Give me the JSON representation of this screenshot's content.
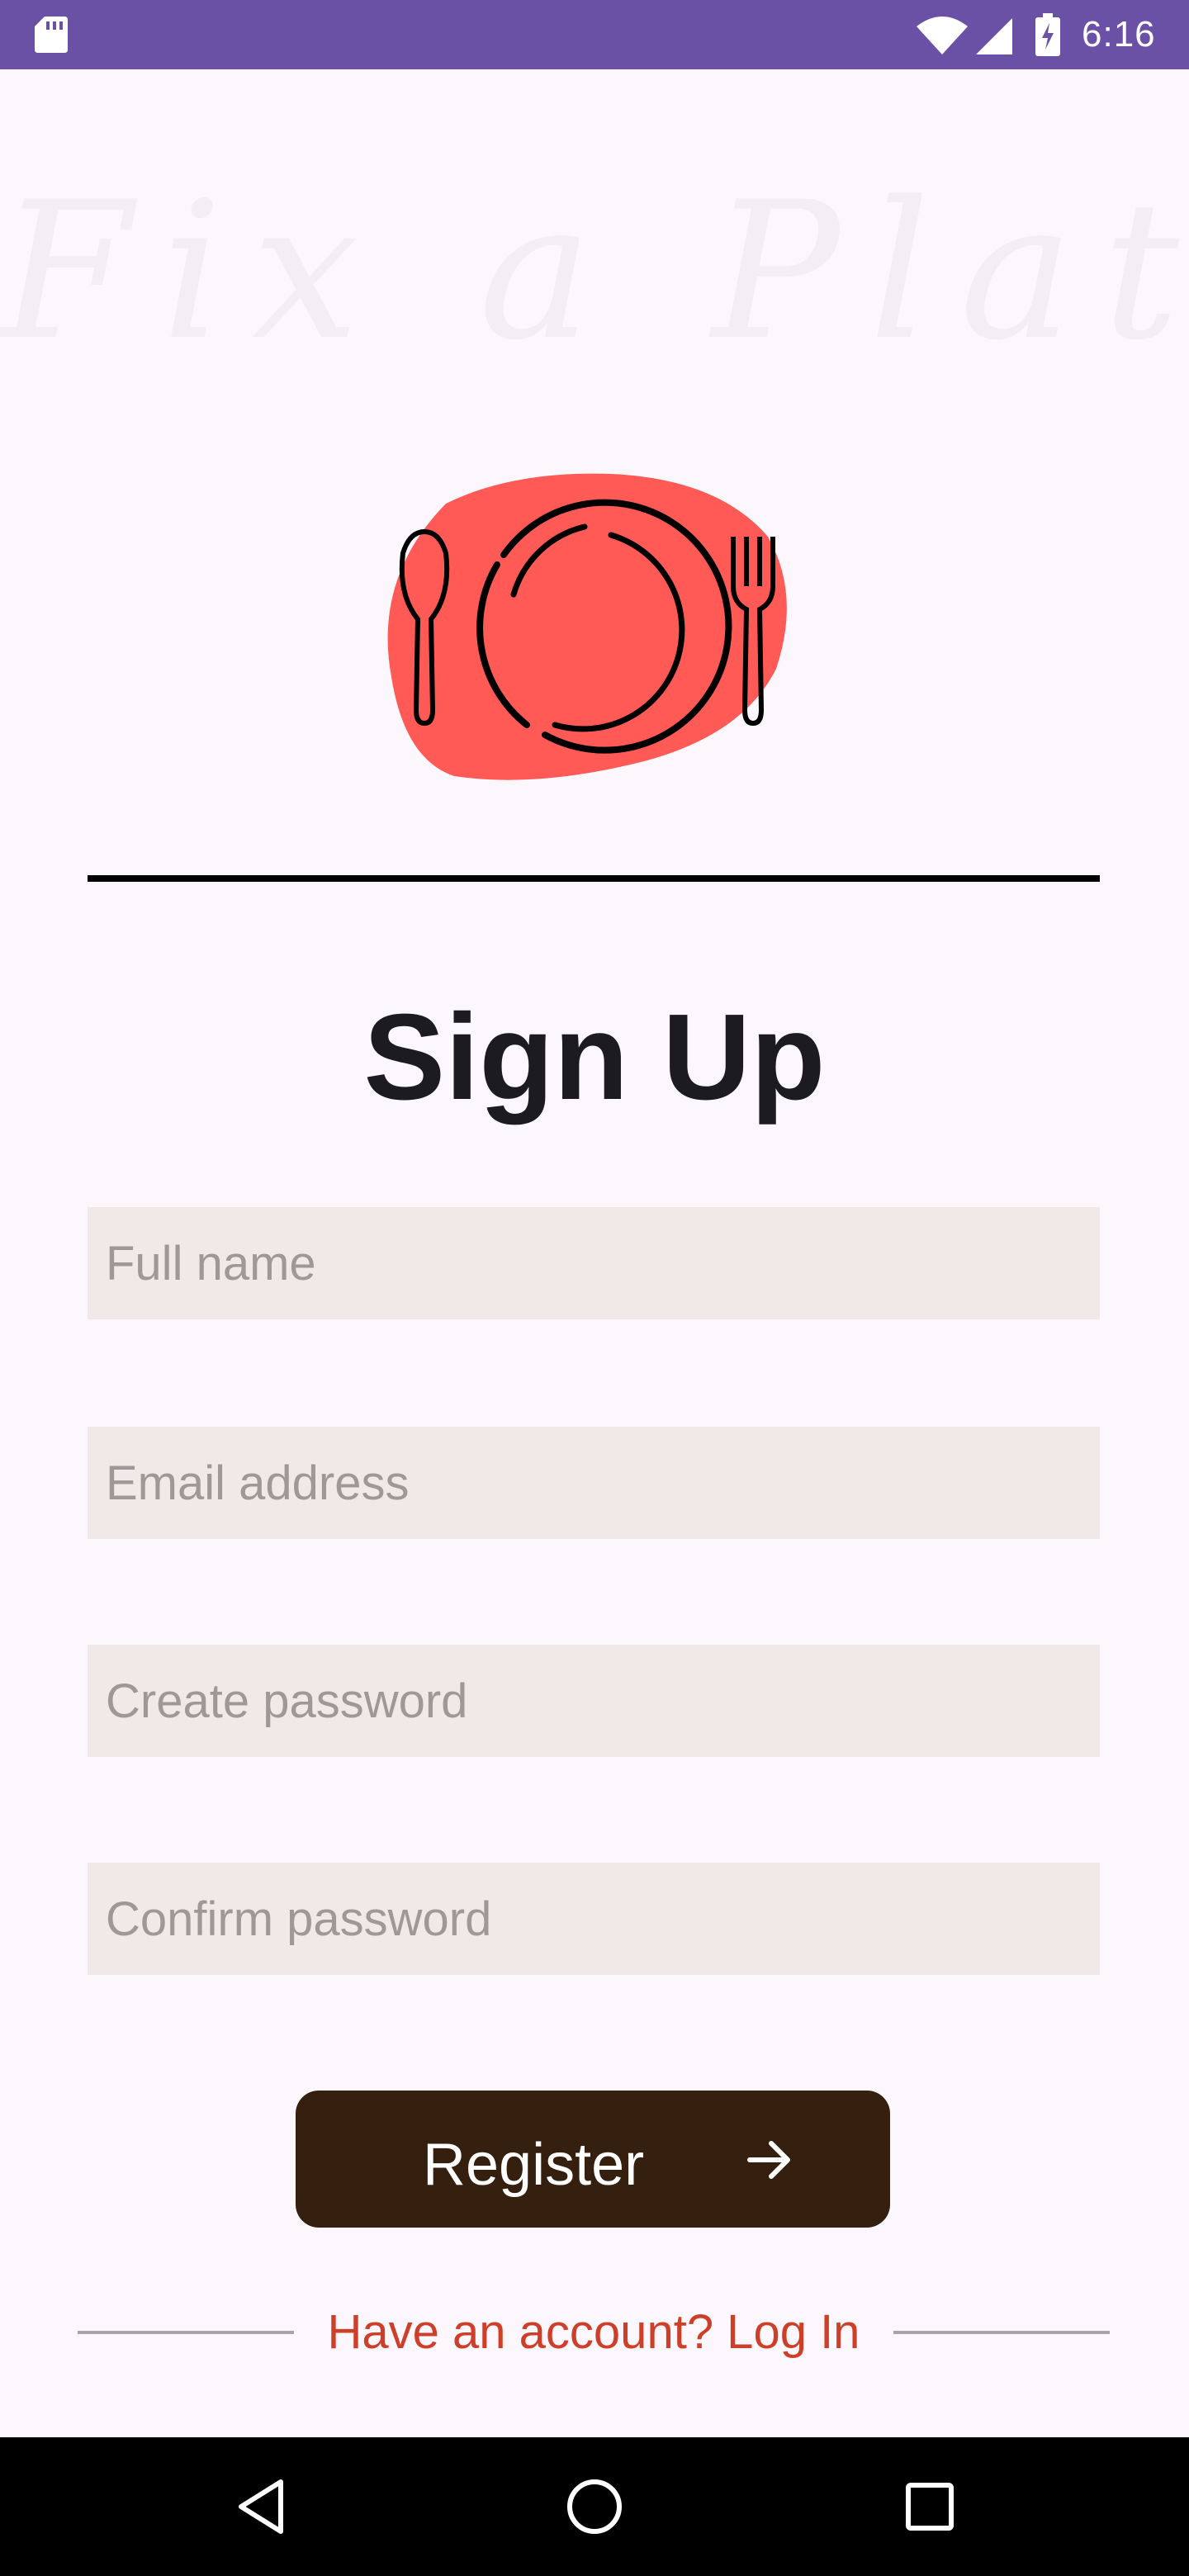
{
  "status_bar": {
    "time": "6:16",
    "icons": [
      "sd-card-icon",
      "wifi-icon",
      "signal-icon",
      "battery-icon"
    ],
    "background_color": "#6A51A6"
  },
  "brand": {
    "title": "Fix a Plate",
    "logo": "plate-fork-spoon-icon",
    "logo_color": "#FF5A55"
  },
  "page": {
    "title": "Sign Up"
  },
  "form": {
    "full_name": {
      "placeholder": "Full name",
      "value": ""
    },
    "email": {
      "placeholder": "Email address",
      "value": ""
    },
    "password": {
      "placeholder": "Create password",
      "value": ""
    },
    "confirm_password": {
      "placeholder": "Confirm password",
      "value": ""
    },
    "register_button": {
      "label": "Register",
      "icon": "arrow-right-icon",
      "color": "#35200F"
    }
  },
  "footer": {
    "login_link": "Have an account? Log In",
    "link_color": "#CE3F2A"
  },
  "navigation_bar": {
    "buttons": [
      "back-icon",
      "home-icon",
      "recents-icon"
    ]
  }
}
